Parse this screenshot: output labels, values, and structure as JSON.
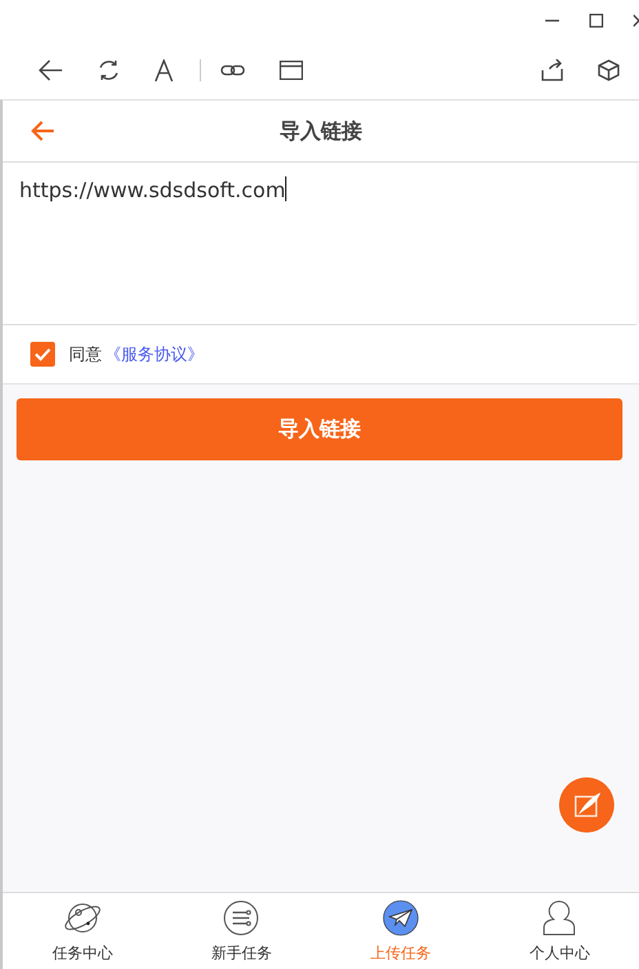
{
  "header": {
    "title": "导入链接"
  },
  "link_field": {
    "value": "https://www.sdsdsoft.com"
  },
  "agreement": {
    "checked": true,
    "text": "同意",
    "link": "《服务协议》"
  },
  "submit_button": {
    "label": "导入链接"
  },
  "tabs": [
    {
      "label": "任务中心",
      "selected": false
    },
    {
      "label": "新手任务",
      "selected": false
    },
    {
      "label": "上传任务",
      "selected": true
    },
    {
      "label": "个人中心",
      "selected": false
    }
  ]
}
